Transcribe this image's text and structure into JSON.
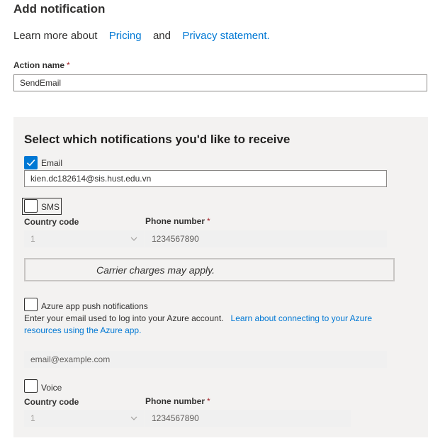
{
  "header": {
    "title": "Add notification",
    "learn_prefix": "Learn more about",
    "pricing_link": "Pricing",
    "and_text": "and",
    "privacy_link": "Privacy statement."
  },
  "action": {
    "label": "Action name",
    "required_mark": "*",
    "value": "SendEmail"
  },
  "notifications": {
    "title": "Select which notifications you'd like to receive",
    "email": {
      "label": "Email",
      "checked": true,
      "value": "kien.dc182614@sis.hust.edu.vn"
    },
    "sms": {
      "label": "SMS",
      "checked": false,
      "country_code_label": "Country code",
      "country_code_value": "1",
      "phone_label": "Phone number",
      "phone_required": "*",
      "phone_value": "1234567890",
      "carrier_note": "Carrier charges may apply."
    },
    "push": {
      "label": "Azure app push notifications",
      "checked": false,
      "description": "Enter your email used to log into your Azure account.",
      "link_line1": "Learn about connecting to your Azure",
      "link_line2": "resources using the Azure app.",
      "email_placeholder": "email@example.com"
    },
    "voice": {
      "label": "Voice",
      "checked": false,
      "country_code_label": "Country code",
      "country_code_value": "1",
      "phone_label": "Phone number",
      "phone_required": "*",
      "phone_value": "1234567890"
    }
  },
  "colors": {
    "accent": "#0078d4",
    "panel": "#f3f2f1",
    "required": "#a4262c"
  }
}
